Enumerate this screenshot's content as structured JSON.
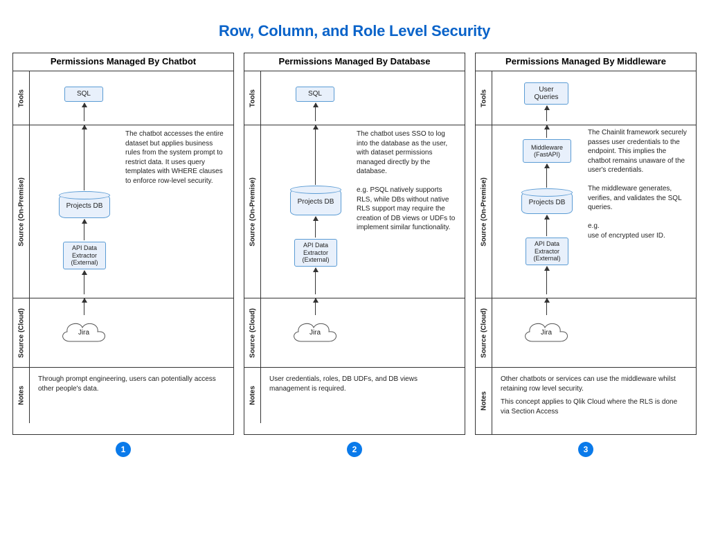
{
  "title": "Row, Column, and Role Level Security",
  "lane_labels": {
    "tools": "Tools",
    "onprem": "Source (On-Premise)",
    "cloud": "Source (Cloud)",
    "notes": "Notes"
  },
  "panels": [
    {
      "badge": "1",
      "title": "Permissions Managed By Chatbot",
      "tools_node": "SQL",
      "db_node": "Projects DB",
      "extractor_node": "API Data\nExtractor\n(External)",
      "middleware_node": null,
      "cloud_node": "Jira",
      "onprem_desc": "The chatbot accesses the entire dataset but applies business rules from the system prompt to restrict data. It uses query templates with WHERE clauses to enforce row-level security.",
      "notes": [
        "Through prompt engineering, users can potentially access other people's data."
      ]
    },
    {
      "badge": "2",
      "title": "Permissions Managed By Database",
      "tools_node": "SQL",
      "db_node": "Projects DB",
      "extractor_node": "API Data\nExtractor\n(External)",
      "middleware_node": null,
      "cloud_node": "Jira",
      "onprem_desc": "The chatbot uses SSO to log into the database as the user, with dataset permissions managed directly by the database.\n\ne.g. PSQL natively supports RLS, while DBs without native RLS support may require the creation of DB views or UDFs to implement similar functionality.",
      "notes": [
        "User credentials, roles, DB UDFs, and DB views management is required."
      ]
    },
    {
      "badge": "3",
      "title": "Permissions Managed By Middleware",
      "tools_node": "User\nQueries",
      "db_node": "Projects DB",
      "extractor_node": "API Data\nExtractor\n(External)",
      "middleware_node": "Middleware\n(FastAPI)",
      "cloud_node": "Jira",
      "onprem_desc": "The Chainlit framework securely passes user credentials to the endpoint. This implies the chatbot remains unaware of the user's credentials.\n\nThe middleware generates, verifies, and validates the SQL queries.\n\ne.g.\nuse of encrypted user ID.",
      "notes": [
        "Other chatbots or services can use the middleware whilst retaining row level security.",
        "This concept applies to Qlik Cloud where the RLS is done via Section Access"
      ]
    }
  ]
}
